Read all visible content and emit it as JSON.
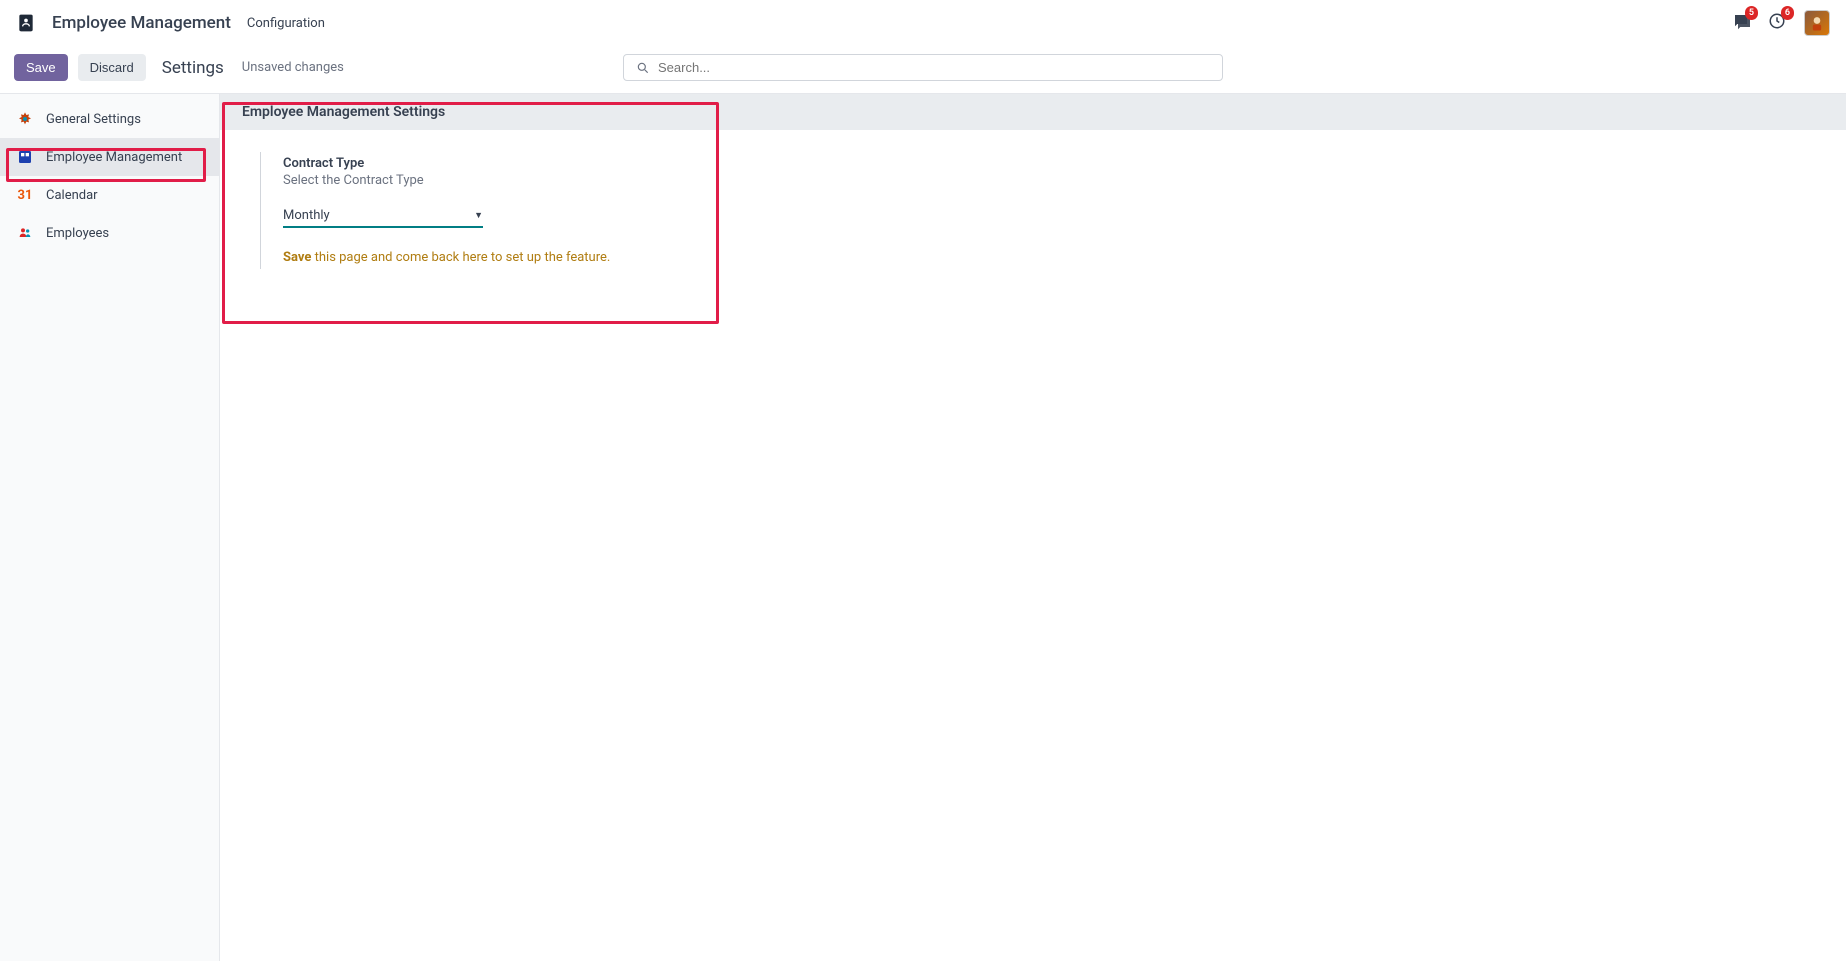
{
  "header": {
    "app_title": "Employee Management",
    "menu_item": "Configuration"
  },
  "actionbar": {
    "save_label": "Save",
    "discard_label": "Discard",
    "view_title": "Settings",
    "status": "Unsaved changes",
    "search_placeholder": "Search..."
  },
  "badges": {
    "messages": "5",
    "activities": "6"
  },
  "sidebar": {
    "items": [
      {
        "label": "General Settings"
      },
      {
        "label": "Employee Management"
      },
      {
        "label": "Calendar"
      },
      {
        "label": "Employees"
      }
    ]
  },
  "main": {
    "section_title": "Employee Management Settings",
    "setting_title": "Contract Type",
    "setting_desc": "Select the Contract Type",
    "select_value": "Monthly",
    "hint_strong": "Save",
    "hint_rest": " this page and come back here to set up the feature."
  }
}
